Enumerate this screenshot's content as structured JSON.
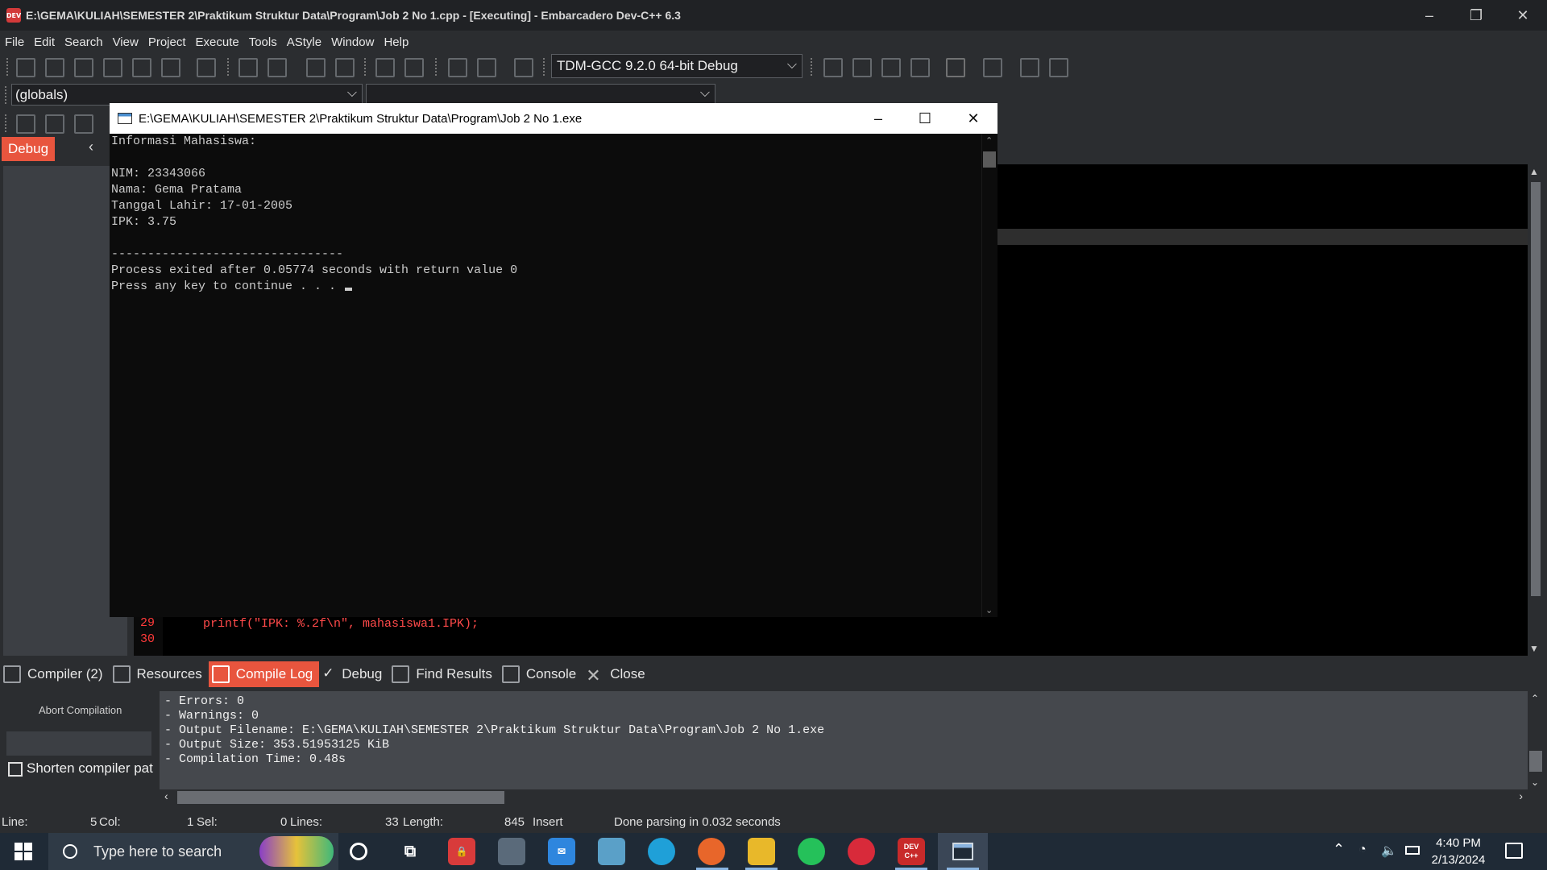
{
  "window": {
    "title": "E:\\GEMA\\KULIAH\\SEMESTER 2\\Praktikum Struktur Data\\Program\\Job 2 No 1.cpp - [Executing] - Embarcadero Dev-C++ 6.3",
    "app_icon_text": "DEV"
  },
  "menu": [
    "File",
    "Edit",
    "Search",
    "View",
    "Project",
    "Execute",
    "Tools",
    "AStyle",
    "Window",
    "Help"
  ],
  "toolbar": {
    "compiler": "TDM-GCC 9.2.0 64-bit Debug",
    "scope": "(globals)",
    "member": ""
  },
  "left_panel": {
    "tab": "Debug",
    "collapse": "‹"
  },
  "console": {
    "title": "E:\\GEMA\\KULIAH\\SEMESTER 2\\Praktikum Struktur Data\\Program\\Job 2 No 1.exe",
    "lines": [
      "Informasi Mahasiswa:",
      "",
      "NIM: 23343066",
      "Nama: Gema Pratama",
      "Tanggal Lahir: 17-01-2005",
      "IPK: 3.75",
      "",
      "--------------------------------",
      "Process exited after 0.05774 seconds with return value 0",
      "Press any key to continue . . . "
    ]
  },
  "editor": {
    "line_numbers": [
      "29",
      "30"
    ],
    "code_line": "printf(\"IPK: %.2f\\n\", mahasiswa1.IPK);"
  },
  "bottom_tabs": [
    {
      "label": "Compiler (2)",
      "active": false
    },
    {
      "label": "Resources",
      "active": false
    },
    {
      "label": "Compile Log",
      "active": true
    },
    {
      "label": "Debug",
      "active": false
    },
    {
      "label": "Find Results",
      "active": false
    },
    {
      "label": "Console",
      "active": false
    },
    {
      "label": "Close",
      "active": false
    }
  ],
  "compile_pane": {
    "abort_label": "Abort Compilation",
    "shorten_label": "Shorten compiler paths",
    "log": [
      "- Errors: 0",
      "- Warnings: 0",
      "- Output Filename: E:\\GEMA\\KULIAH\\SEMESTER 2\\Praktikum Struktur Data\\Program\\Job 2 No 1.exe",
      "- Output Size: 353.51953125 KiB",
      "- Compilation Time: 0.48s"
    ]
  },
  "status": {
    "line_label": "Line:",
    "line_value": "5",
    "col_label": "Col:",
    "col_value": "1",
    "sel_label": "Sel:",
    "sel_value": "0",
    "lines_label": "Lines:",
    "lines_value": "33",
    "length_label": "Length:",
    "length_value": "845",
    "mode": "Insert",
    "message": "Done parsing in 0.032 seconds"
  },
  "taskbar": {
    "search_placeholder": "Type here to search",
    "time": "4:40 PM",
    "date": "2/13/2024",
    "devcpp_label": "DEV C++"
  },
  "colors": {
    "accent": "#e8553e",
    "console_bg": "#0c0c0c",
    "code_red": "#ff4a4a"
  }
}
